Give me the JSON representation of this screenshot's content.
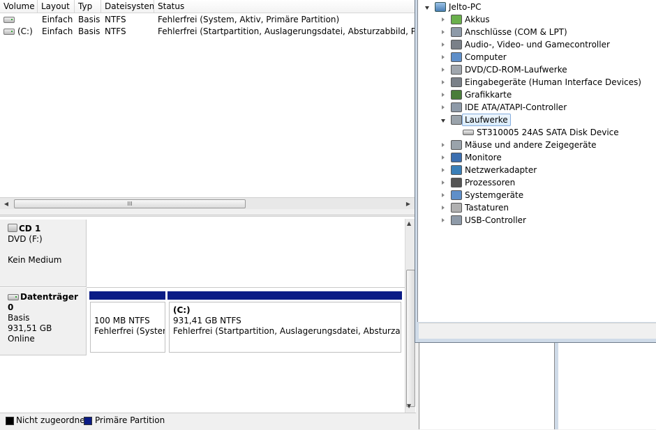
{
  "volume_list": {
    "columns": [
      "Volume",
      "Layout",
      "Typ",
      "Dateisystem",
      "Status"
    ],
    "rows": [
      {
        "volume": "",
        "layout": "Einfach",
        "typ": "Basis",
        "fs": "NTFS",
        "status": "Fehlerfrei (System, Aktiv, Primäre Partition)"
      },
      {
        "volume": "(C:)",
        "layout": "Einfach",
        "typ": "Basis",
        "fs": "NTFS",
        "status": "Fehlerfrei (Startpartition, Auslagerungsdatei, Absturzabbild, Primäre Pa"
      }
    ],
    "scroll_thumb_glyph": "III"
  },
  "disks": [
    {
      "name": "CD 1",
      "line2": "DVD (F:)",
      "line3": "",
      "line4": "Kein Medium"
    },
    {
      "name": "Datenträger 0",
      "line2": "Basis",
      "line3": "931,51 GB",
      "line4": "Online",
      "partitions": [
        {
          "title": "",
          "size": "100 MB NTFS",
          "status": "Fehlerfrei (System,"
        },
        {
          "title": "(C:)",
          "size": "931,41 GB NTFS",
          "status": "Fehlerfrei (Startpartition, Auslagerungsdatei, Absturzabbild, P"
        }
      ]
    }
  ],
  "legend": [
    {
      "label": "Nicht zugeordnet",
      "color": "#000000"
    },
    {
      "label": "Primäre Partition",
      "color": "#0b1c86"
    }
  ],
  "device_manager": {
    "root": "Jelto-PC",
    "categories": [
      {
        "label": "Akkus",
        "icon": "battery-icon"
      },
      {
        "label": "Anschlüsse (COM & LPT)",
        "icon": "port-icon"
      },
      {
        "label": "Audio-, Video- und Gamecontroller",
        "icon": "speaker-icon"
      },
      {
        "label": "Computer",
        "icon": "computer-icon"
      },
      {
        "label": "DVD/CD-ROM-Laufwerke",
        "icon": "dvd-drive-icon"
      },
      {
        "label": "Eingabegeräte (Human Interface Devices)",
        "icon": "hid-icon"
      },
      {
        "label": "Grafikkarte",
        "icon": "display-adapter-icon"
      },
      {
        "label": "IDE ATA/ATAPI-Controller",
        "icon": "ide-controller-icon"
      },
      {
        "label": "Laufwerke",
        "icon": "disk-drive-icon",
        "expanded": true,
        "selected": true,
        "children": [
          "ST310005 24AS SATA Disk Device"
        ]
      },
      {
        "label": "Mäuse und andere Zeigegeräte",
        "icon": "mouse-icon"
      },
      {
        "label": "Monitore",
        "icon": "monitor-icon"
      },
      {
        "label": "Netzwerkadapter",
        "icon": "network-adapter-icon"
      },
      {
        "label": "Prozessoren",
        "icon": "processor-icon"
      },
      {
        "label": "Systemgeräte",
        "icon": "system-devices-icon"
      },
      {
        "label": "Tastaturen",
        "icon": "keyboard-icon"
      },
      {
        "label": "USB-Controller",
        "icon": "usb-icon"
      }
    ]
  }
}
